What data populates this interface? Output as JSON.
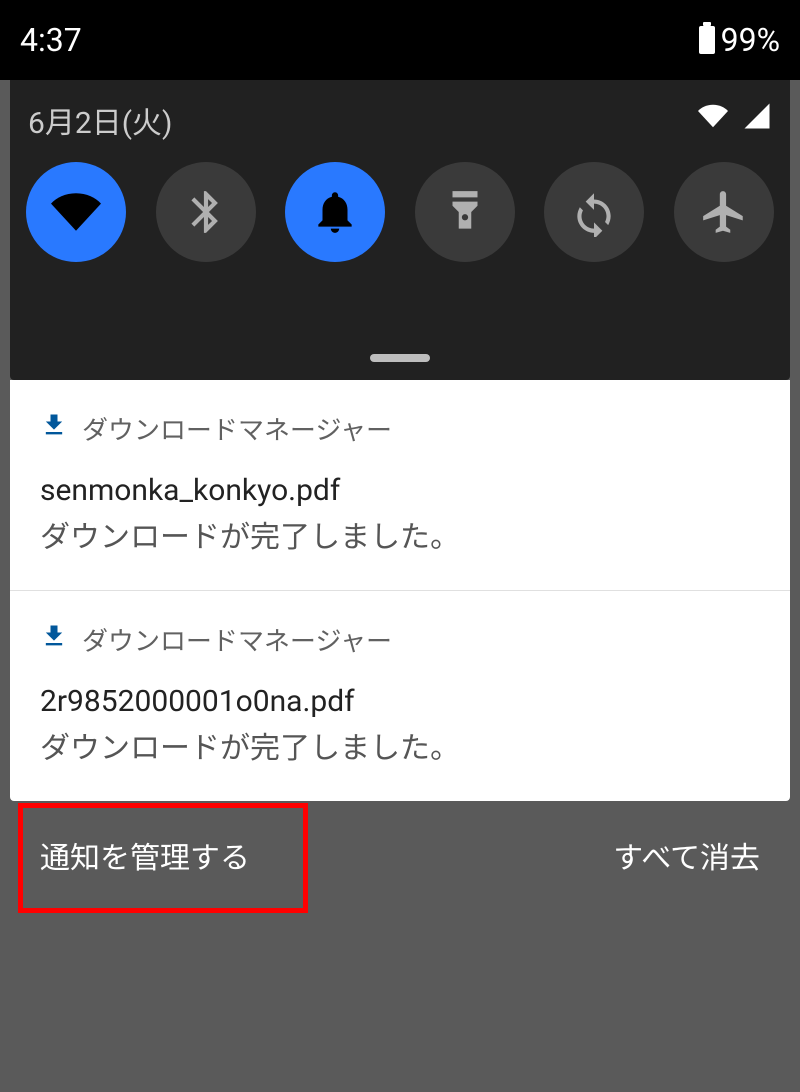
{
  "status": {
    "time": "4:37",
    "battery_pct": "99%"
  },
  "qs": {
    "date": "6月2日(火)",
    "tiles": [
      {
        "name": "wifi",
        "active": true
      },
      {
        "name": "bluetooth",
        "active": false
      },
      {
        "name": "dnd",
        "active": true
      },
      {
        "name": "flashlight",
        "active": false
      },
      {
        "name": "rotate",
        "active": false
      },
      {
        "name": "airplane",
        "active": false
      }
    ]
  },
  "notifications": [
    {
      "app": "ダウンロードマネージャー",
      "title": "senmonka_konkyo.pdf",
      "body": "ダウンロードが完了しました。"
    },
    {
      "app": "ダウンロードマネージャー",
      "title": "2r9852000001o0na.pdf",
      "body": "ダウンロードが完了しました。"
    }
  ],
  "actions": {
    "manage": "通知を管理する",
    "clear_all": "すべて消去"
  }
}
